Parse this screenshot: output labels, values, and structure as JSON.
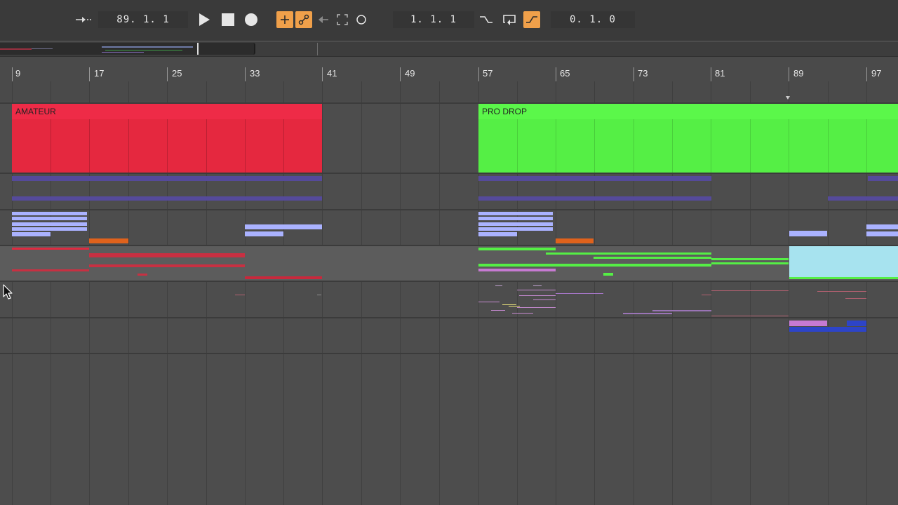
{
  "transport": {
    "follow_icon": "arrow-right-dashed-icon",
    "arrangement_position": "89. 1. 1",
    "play_icon": "play-icon",
    "stop_icon": "stop-icon",
    "record_icon": "record-icon",
    "overdub_icon": "plus-icon",
    "automation_arm_icon": "automation-arm-icon",
    "back_to_arrangement_icon": "back-arrow-icon",
    "capture_icon": "capture-icon",
    "session_record_icon": "circle-icon",
    "loop_start": "1. 1. 1",
    "punch_in_icon": "punch-in-icon",
    "loop_icon": "loop-icon",
    "punch_out_icon": "punch-out-icon",
    "loop_length": "0. 1. 0"
  },
  "ruler": {
    "bars": [
      "9",
      "17",
      "25",
      "33",
      "41",
      "49",
      "57",
      "65",
      "73",
      "81",
      "89",
      "97"
    ]
  },
  "clips": [
    {
      "name": "AMATEUR",
      "color": "#ee2b47"
    },
    {
      "name": "PRO DROP",
      "color": "#5bf74a"
    }
  ],
  "colors": {
    "accent_orange": "#f0a04a",
    "background": "#4d4d4d"
  }
}
